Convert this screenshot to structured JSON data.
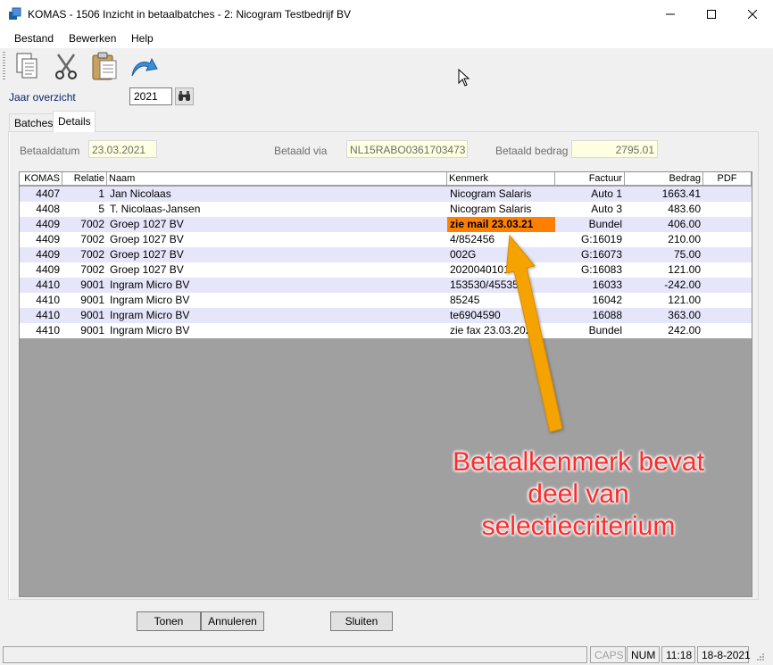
{
  "window": {
    "title": "KOMAS - 1506 Inzicht in betaalbatches - 2: Nicogram Testbedrijf BV"
  },
  "menu": {
    "items": [
      "Bestand",
      "Bewerken",
      "Help"
    ]
  },
  "toolbar": {
    "icons": [
      "document-icon",
      "scissors-icon",
      "clipboard-icon",
      "undo-arrow-icon"
    ]
  },
  "filter": {
    "label": "Jaar overzicht",
    "year": "2021"
  },
  "tabs": {
    "batches": "Batches",
    "details": "Details"
  },
  "details": {
    "betaaldatum_label": "Betaaldatum",
    "betaaldatum": "23.03.2021",
    "betaald_via_label": "Betaald via",
    "betaald_via": "NL15RABO0361703473",
    "betaald_bedrag_label": "Betaald bedrag",
    "betaald_bedrag": "2795.01"
  },
  "table": {
    "columns": [
      "KOMAS",
      "Relatie",
      "Naam",
      "Kenmerk",
      "Factuur",
      "Bedrag",
      "PDF"
    ],
    "rows": [
      {
        "komas": "4407",
        "relatie": "1",
        "naam": "Jan Nicolaas",
        "kenmerk": "Nicogram Salaris",
        "factuur": "Auto 1",
        "bedrag": "1663.41",
        "pdf": ""
      },
      {
        "komas": "4408",
        "relatie": "5",
        "naam": "T. Nicolaas-Jansen",
        "kenmerk": "Nicogram Salaris",
        "factuur": "Auto 3",
        "bedrag": "483.60",
        "pdf": ""
      },
      {
        "komas": "4409",
        "relatie": "7002",
        "naam": "Groep 1027 BV",
        "kenmerk": "zie mail 23.03.21",
        "factuur": "Bundel",
        "bedrag": "406.00",
        "pdf": ""
      },
      {
        "komas": "4409",
        "relatie": "7002",
        "naam": "Groep 1027 BV",
        "kenmerk": "4/852456",
        "factuur": "G:16019",
        "bedrag": "210.00",
        "pdf": ""
      },
      {
        "komas": "4409",
        "relatie": "7002",
        "naam": "Groep 1027 BV",
        "kenmerk": "002G",
        "factuur": "G:16073",
        "bedrag": "75.00",
        "pdf": ""
      },
      {
        "komas": "4409",
        "relatie": "7002",
        "naam": "Groep 1027 BV",
        "kenmerk": "2020040101",
        "factuur": "G:16083",
        "bedrag": "121.00",
        "pdf": ""
      },
      {
        "komas": "4410",
        "relatie": "9001",
        "naam": "Ingram Micro BV",
        "kenmerk": "153530/45535",
        "factuur": "16033",
        "bedrag": "-242.00",
        "pdf": ""
      },
      {
        "komas": "4410",
        "relatie": "9001",
        "naam": "Ingram Micro BV",
        "kenmerk": "85245",
        "factuur": "16042",
        "bedrag": "121.00",
        "pdf": ""
      },
      {
        "komas": "4410",
        "relatie": "9001",
        "naam": "Ingram Micro BV",
        "kenmerk": "te6904590",
        "factuur": "16088",
        "bedrag": "363.00",
        "pdf": ""
      },
      {
        "komas": "4410",
        "relatie": "9001",
        "naam": "Ingram Micro BV",
        "kenmerk": "zie fax 23.03.2021",
        "factuur": "Bundel",
        "bedrag": "242.00",
        "pdf": ""
      }
    ],
    "highlight": {
      "row": 2,
      "column": "kenmerk",
      "color": "#ff8000"
    },
    "alt_row_color": "#e6e6fa"
  },
  "buttons": {
    "tonen": "Tonen",
    "annuleren": "Annuleren",
    "sluiten": "Sluiten"
  },
  "statusbar": {
    "main": "",
    "caps": "CAPS",
    "num": "NUM",
    "time": "11:18",
    "date": "18-8-2021"
  },
  "annotation": {
    "lines": [
      "Betaalkenmerk bevat",
      "deel van",
      "selectiecriterium"
    ],
    "text_color": "#ff2a2a",
    "arrow_color": "#f5a300"
  }
}
